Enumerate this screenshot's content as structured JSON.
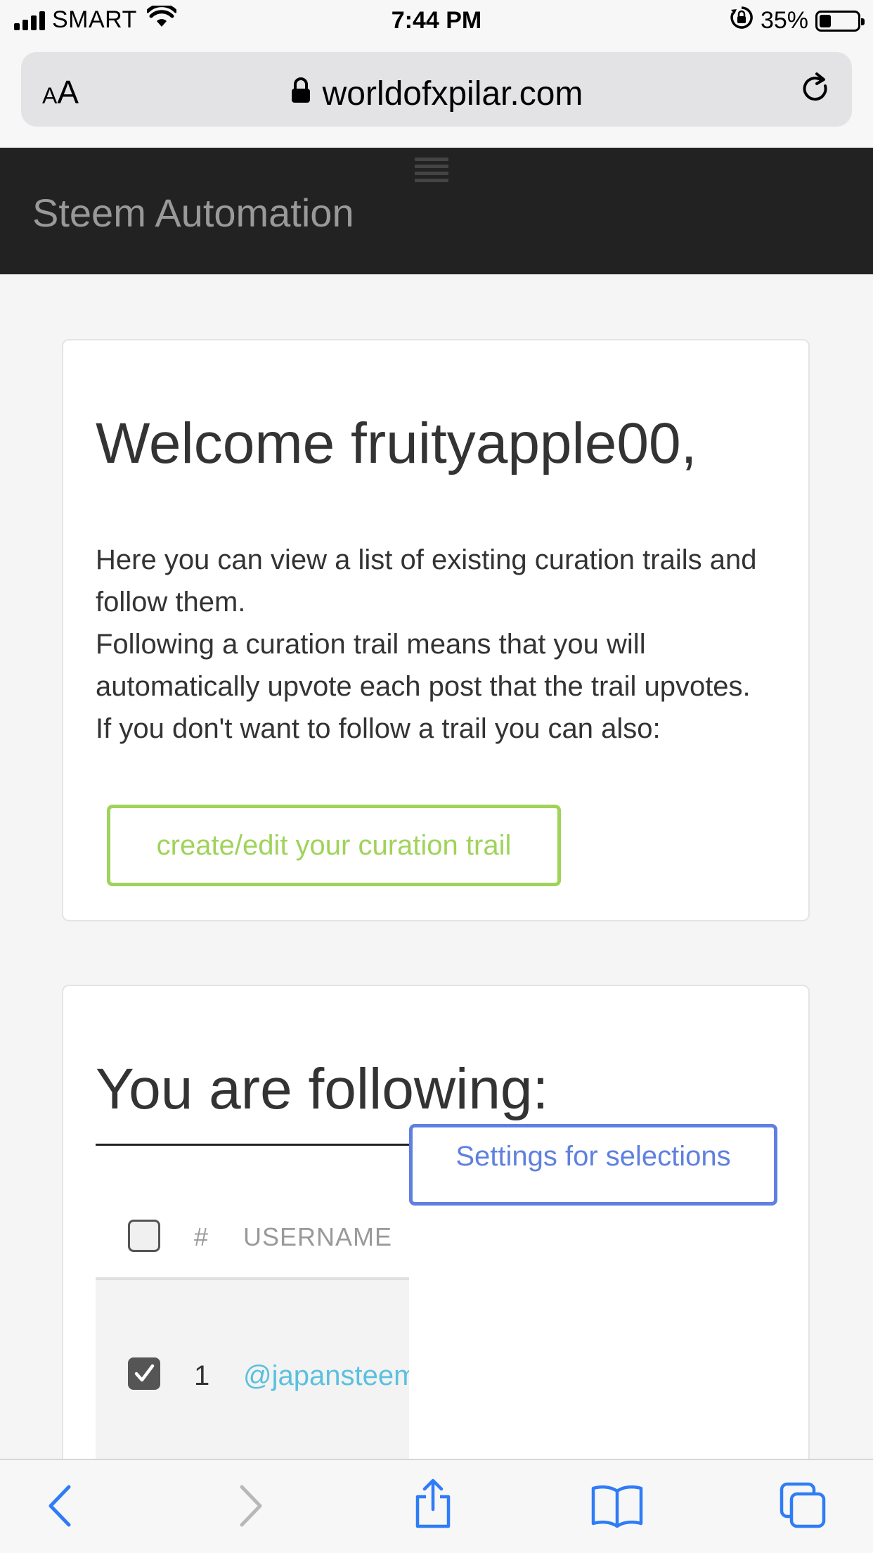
{
  "status_bar": {
    "carrier": "SMART",
    "time": "7:44 PM",
    "battery_percent": "35%",
    "battery_level": 0.35,
    "icons": [
      "signal-icon",
      "wifi-icon",
      "rotation-lock-icon",
      "battery-icon"
    ]
  },
  "browser": {
    "text_size_label_small": "A",
    "text_size_label_large": "A",
    "url": "worldofxpilar.com",
    "icons": [
      "lock-icon",
      "reload-icon"
    ]
  },
  "navbar": {
    "brand": "Steem Automation",
    "icons": [
      "hamburger-menu-icon"
    ]
  },
  "welcome_card": {
    "title": "Welcome fruityapple00,",
    "paragraph_1": "Here you can view a list of existing curation trails and follow them.",
    "paragraph_2": "Following a curation trail means that you will automatically upvote each post that the trail upvotes.",
    "paragraph_3": "If you don't want to follow a trail you can also:",
    "create_button": "create/edit your curation trail",
    "colors": {
      "create_button": "#9fd35a"
    }
  },
  "following_card": {
    "title": "You are following:",
    "settings_button": "Settings for selections",
    "colors": {
      "settings_button": "#5f80e0",
      "username_link": "#5bc0de"
    },
    "table": {
      "headers": {
        "number": "#",
        "username": "USERNAME"
      },
      "header_checked": false,
      "rows": [
        {
          "number": "1",
          "username": "@japansteemit",
          "checked": true
        }
      ]
    }
  },
  "toolbar": {
    "icons": [
      "back-icon",
      "forward-icon",
      "share-icon",
      "bookmarks-icon",
      "tabs-icon"
    ]
  }
}
